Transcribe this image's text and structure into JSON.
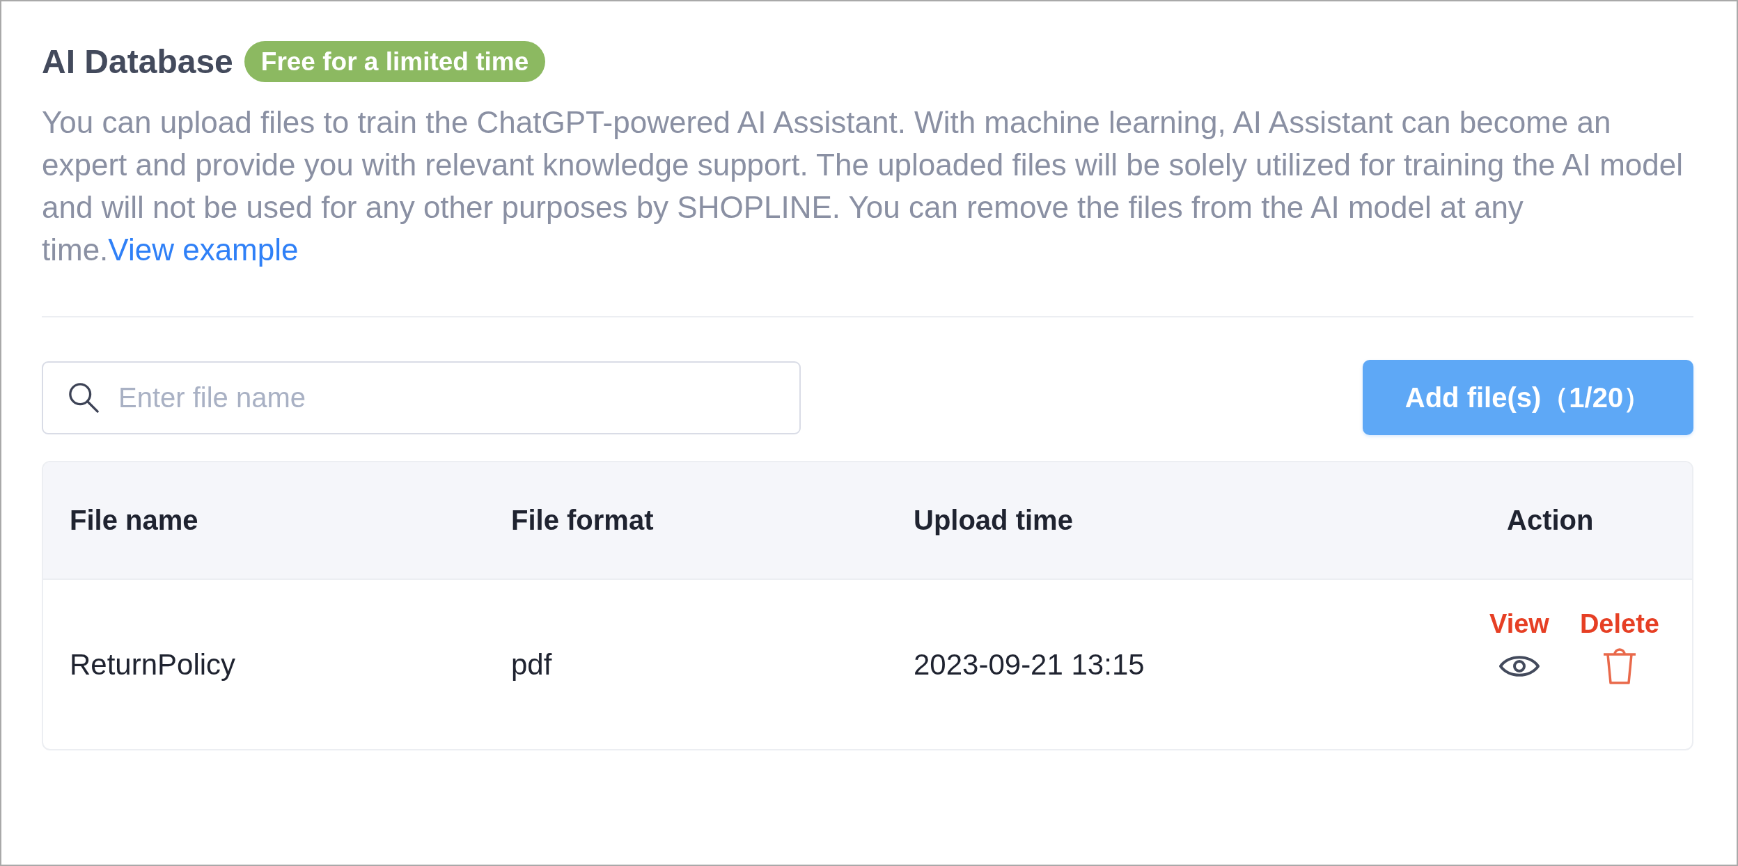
{
  "header": {
    "title": "AI Database",
    "badge": "Free for a limited time"
  },
  "description": {
    "text": "You can upload files to train the ChatGPT-powered AI Assistant. With machine learning, AI Assistant can become an expert and provide you with relevant knowledge support. The uploaded files will be solely utilized for training the AI model and will not be used for any other purposes by SHOPLINE. You can remove the files from the AI model at any time.",
    "link": "View example"
  },
  "search": {
    "placeholder": "Enter file name"
  },
  "add_button": {
    "label": "Add file(s)（1/20）"
  },
  "table": {
    "columns": [
      "File name",
      "File format",
      "Upload time",
      "Action"
    ],
    "rows": [
      {
        "cells": [
          "ReturnPolicy",
          "pdf",
          "2023-09-21 13:15"
        ],
        "actions": [
          {
            "kind": "view",
            "label": "View"
          },
          {
            "kind": "delete",
            "label": "Delete"
          }
        ]
      }
    ]
  }
}
